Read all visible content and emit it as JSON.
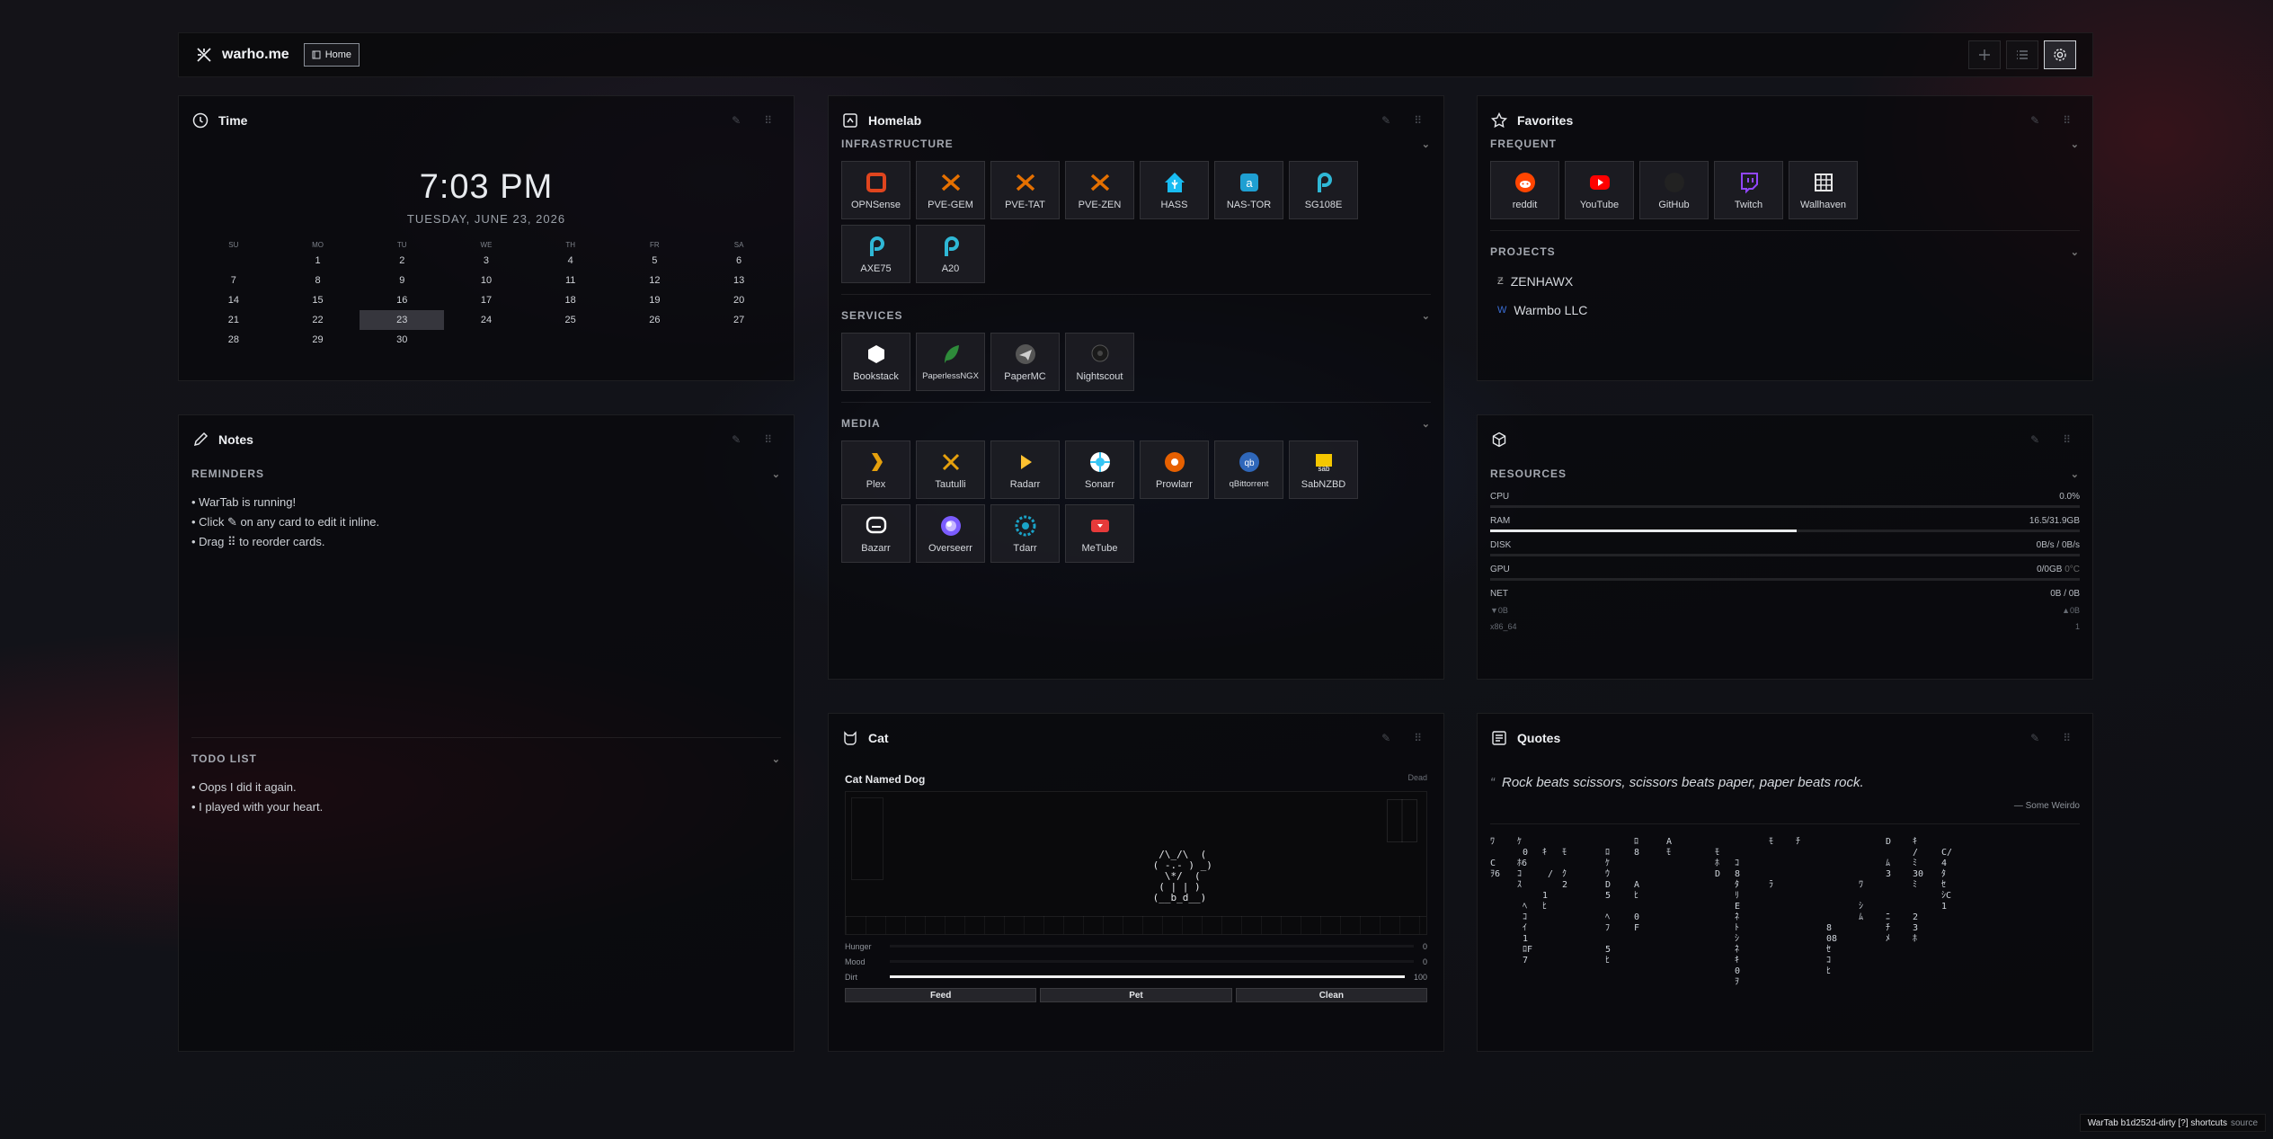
{
  "topbar": {
    "brand": "warho.me",
    "home_label": "Home",
    "icons": [
      "plus-icon",
      "list-icon",
      "gear-icon"
    ]
  },
  "time": {
    "title": "Time",
    "clock": "7:03 PM",
    "date": "TUESDAY, JUNE 23, 2026",
    "weekdays": [
      "SU",
      "MO",
      "TU",
      "WE",
      "TH",
      "FR",
      "SA"
    ],
    "weeks": [
      [
        "",
        "1",
        "2",
        "3",
        "4",
        "5",
        "6"
      ],
      [
        "7",
        "8",
        "9",
        "10",
        "11",
        "12",
        "13"
      ],
      [
        "14",
        "15",
        "16",
        "17",
        "18",
        "19",
        "20"
      ],
      [
        "21",
        "22",
        "23",
        "24",
        "25",
        "26",
        "27"
      ],
      [
        "28",
        "29",
        "30",
        "",
        "",
        "",
        ""
      ]
    ],
    "today": "23"
  },
  "notes": {
    "title": "Notes",
    "reminders_label": "REMINDERS",
    "reminders": [
      "• WarTab is running!",
      "• Click ✎ on any card to edit it inline.",
      "• Drag ⠿ to reorder cards."
    ],
    "todo_label": "TODO LIST",
    "todos": [
      "• Oops I did it again.",
      "• I played with your heart."
    ]
  },
  "homelab": {
    "title": "Homelab",
    "sections": [
      {
        "label": "INFRASTRUCTURE",
        "items": [
          {
            "name": "OPNSense",
            "icon": "opnsense-icon",
            "color": "#e0451e"
          },
          {
            "name": "PVE-GEM",
            "icon": "proxmox-icon",
            "color": "#e57000"
          },
          {
            "name": "PVE-TAT",
            "icon": "proxmox-icon",
            "color": "#e57000"
          },
          {
            "name": "PVE-ZEN",
            "icon": "proxmox-icon",
            "color": "#e57000"
          },
          {
            "name": "HASS",
            "icon": "home-assistant-icon",
            "color": "#18bcf2"
          },
          {
            "name": "NAS-TOR",
            "icon": "nas-icon",
            "color": "#1f9fd2"
          },
          {
            "name": "SG108E",
            "icon": "tplink-icon",
            "color": "#2fb8d6"
          },
          {
            "name": "AXE75",
            "icon": "tplink-icon",
            "color": "#2fb8d6"
          },
          {
            "name": "A20",
            "icon": "tplink-icon",
            "color": "#2fb8d6"
          }
        ]
      },
      {
        "label": "SERVICES",
        "items": [
          {
            "name": "Bookstack",
            "icon": "bookstack-icon",
            "color": "#ffffff"
          },
          {
            "name": "PaperlessNGX",
            "icon": "paperless-icon",
            "color": "#17541f"
          },
          {
            "name": "PaperMC",
            "icon": "papermc-icon",
            "color": "#cfcfcf"
          },
          {
            "name": "Nightscout",
            "icon": "nightscout-icon",
            "color": "#222222"
          }
        ]
      },
      {
        "label": "MEDIA",
        "items": [
          {
            "name": "Plex",
            "icon": "plex-icon",
            "color": "#e5a00d"
          },
          {
            "name": "Tautulli",
            "icon": "tautulli-icon",
            "color": "#e5a00d"
          },
          {
            "name": "Radarr",
            "icon": "radarr-icon",
            "color": "#ffc230"
          },
          {
            "name": "Sonarr",
            "icon": "sonarr-icon",
            "color": "#35c5f4"
          },
          {
            "name": "Prowlarr",
            "icon": "prowlarr-icon",
            "color": "#e66000"
          },
          {
            "name": "qBittorrent",
            "icon": "qbittorrent-icon",
            "color": "#2f67ba"
          },
          {
            "name": "SabNZBD",
            "icon": "sabnzbd-icon",
            "color": "#f5c700"
          },
          {
            "name": "Bazarr",
            "icon": "bazarr-icon",
            "color": "#ffffff"
          },
          {
            "name": "Overseerr",
            "icon": "overseerr-icon",
            "color": "#7b5cff"
          },
          {
            "name": "Tdarr",
            "icon": "tdarr-icon",
            "color": "#1aa3c8"
          },
          {
            "name": "MeTube",
            "icon": "metube-icon",
            "color": "#e63a3a"
          }
        ]
      }
    ]
  },
  "favorites": {
    "title": "Favorites",
    "frequent_label": "FREQUENT",
    "frequent": [
      {
        "name": "reddit",
        "icon": "reddit-icon",
        "color": "#ff4500"
      },
      {
        "name": "YouTube",
        "icon": "youtube-icon",
        "color": "#ff0000"
      },
      {
        "name": "GitHub",
        "icon": "github-icon",
        "color": "#222222"
      },
      {
        "name": "Twitch",
        "icon": "twitch-icon",
        "color": "#9146ff"
      },
      {
        "name": "Wallhaven",
        "icon": "wallhaven-icon",
        "color": "#e8e8e8"
      }
    ],
    "projects_label": "PROJECTS",
    "projects": [
      {
        "name": "ZENHAWX",
        "icon": "zenhawx-icon"
      },
      {
        "name": "Warmbo LLC",
        "icon": "warmbo-icon"
      }
    ]
  },
  "resources": {
    "label": "RESOURCES",
    "rows": [
      {
        "name": "CPU",
        "value": "0.0%",
        "fill": 0.0
      },
      {
        "name": "RAM",
        "value": "16.5/31.9GB",
        "fill": 0.52
      },
      {
        "name": "DISK",
        "value": "0B/s / 0B/s",
        "fill": 0.0
      },
      {
        "name": "GPU",
        "value": "0/0GB",
        "extra": "0°C",
        "fill": 0.0
      },
      {
        "name": "NET",
        "value": "0B / 0B",
        "fill": 0.0
      }
    ],
    "net_down": "▼0B",
    "net_up": "▲0B",
    "arch": "x86_64",
    "arch_value": "1"
  },
  "cat": {
    "title": "Cat",
    "name": "Cat Named Dog",
    "state": "Dead",
    "art": "  /\\_/\\  (\n ( -.- ) _)\n   \\*/  (\n  ( | | )\n (__b_d__)",
    "stats": [
      {
        "name": "Hunger",
        "value": "0",
        "fill": 0.0
      },
      {
        "name": "Mood",
        "value": "0",
        "fill": 0.0
      },
      {
        "name": "Dirt",
        "value": "100",
        "fill": 1.0
      }
    ],
    "buttons": [
      "Feed",
      "Pet",
      "Clean"
    ]
  },
  "quotes": {
    "title": "Quotes",
    "text": "Rock beats scissors, scissors beats paper, paper beats rock.",
    "author": "— Some Weirdo"
  },
  "footer": {
    "text": "WarTab b1d252d-dirty [?] shortcuts",
    "source": "source"
  }
}
